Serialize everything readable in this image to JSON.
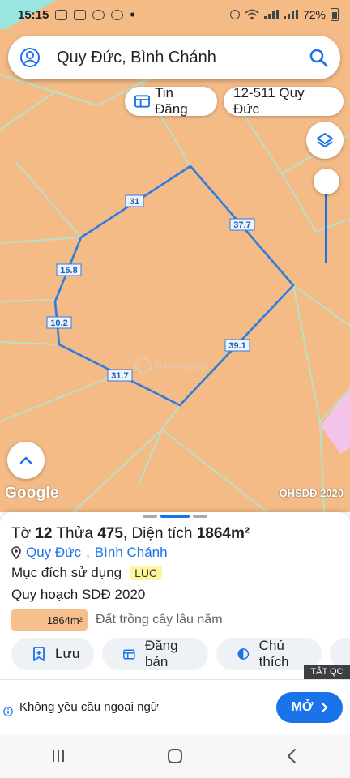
{
  "status_bar": {
    "time": "15:15",
    "battery": "72%",
    "icons": [
      "image-icon",
      "photo-icon",
      "camera-icon",
      "compass-icon",
      "dot-icon",
      "alarm-icon",
      "wifi-icon",
      "signal-icon",
      "battery-icon"
    ]
  },
  "search": {
    "query": "Quy Đức, Bình Chánh",
    "left_icon": "account-icon",
    "right_icon": "search-icon"
  },
  "chips": {
    "tin_dang": "Tin Đăng",
    "parcel_code": "12-511 Quy Đức"
  },
  "map": {
    "edge_labels": [
      "31",
      "37.7",
      "15.8",
      "10.2",
      "39.1",
      "31.7"
    ],
    "watermark": "Batdongsan",
    "google": "Google",
    "source": "QHSDĐ 2020",
    "colors": {
      "land": "#f4bb86",
      "parcel_line": "#2b7de0",
      "water": "#9be5e0",
      "grid": "#b7e2c9",
      "pink_zone": "#f2c4ea"
    }
  },
  "panel": {
    "title_prefix": "Tờ ",
    "sheet": "12",
    "lot_label": " Thửa ",
    "lot": "475",
    "area_label": ", Diện tích ",
    "area": "1864m²",
    "address_ward": "Quy Đức",
    "address_separator": ",",
    "address_district": "Bình Chánh",
    "purpose_label": "Mục đích sử dụng",
    "purpose_code": "LUC",
    "plan_label": "Quy hoạch SDĐ 2020",
    "legend_area": "1864m²",
    "legend_label": "Đất trồng cây lâu năm",
    "actions": {
      "save": "Lưu",
      "post_sale": "Đăng bán",
      "legend": "Chú thích"
    }
  },
  "ad": {
    "close_label": "TẮT QC",
    "text": "Không yêu cầu ngoại ngữ",
    "cta": "MỞ"
  }
}
